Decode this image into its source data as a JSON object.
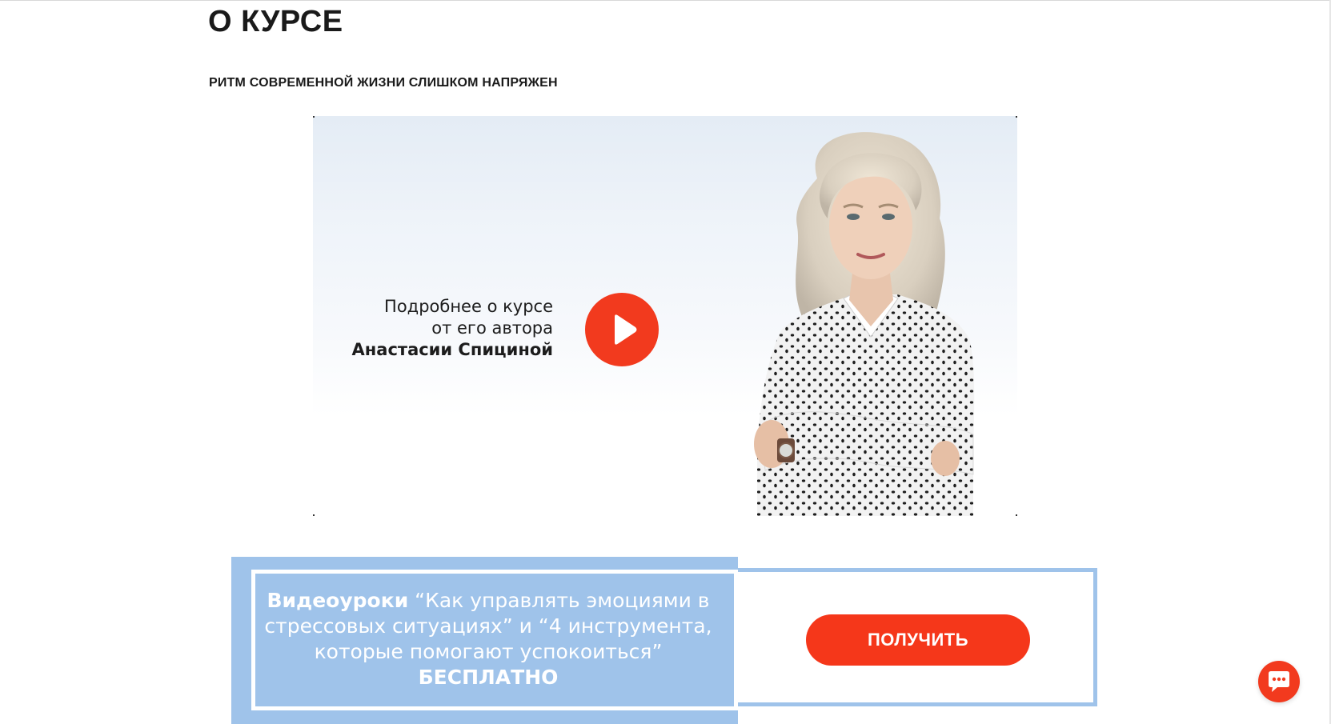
{
  "section": {
    "title": "О КУРСЕ",
    "subtitle": "РИТМ СОВРЕМЕННОЙ ЖИЗНИ СЛИШКОМ НАПРЯЖЕН"
  },
  "video": {
    "caption_line1": "Подробнее о курсе",
    "caption_line2": "от его автора",
    "caption_author": "Анастасии Спициной",
    "play_icon": "play-icon"
  },
  "promo": {
    "bold_prefix": "Видеоуроки",
    "text": " “Как управлять эмоциями в стрессовых ситуациях” и “4 инструмента, которые помогают успокоиться”",
    "free_label": "БЕСПЛАТНО",
    "button_label": "ПОЛУЧИТЬ"
  },
  "chat": {
    "icon": "chat-icon"
  },
  "colors": {
    "accent": "#f23a1e",
    "promo_blue": "#9fc3ea",
    "text": "#1a1a1a"
  }
}
